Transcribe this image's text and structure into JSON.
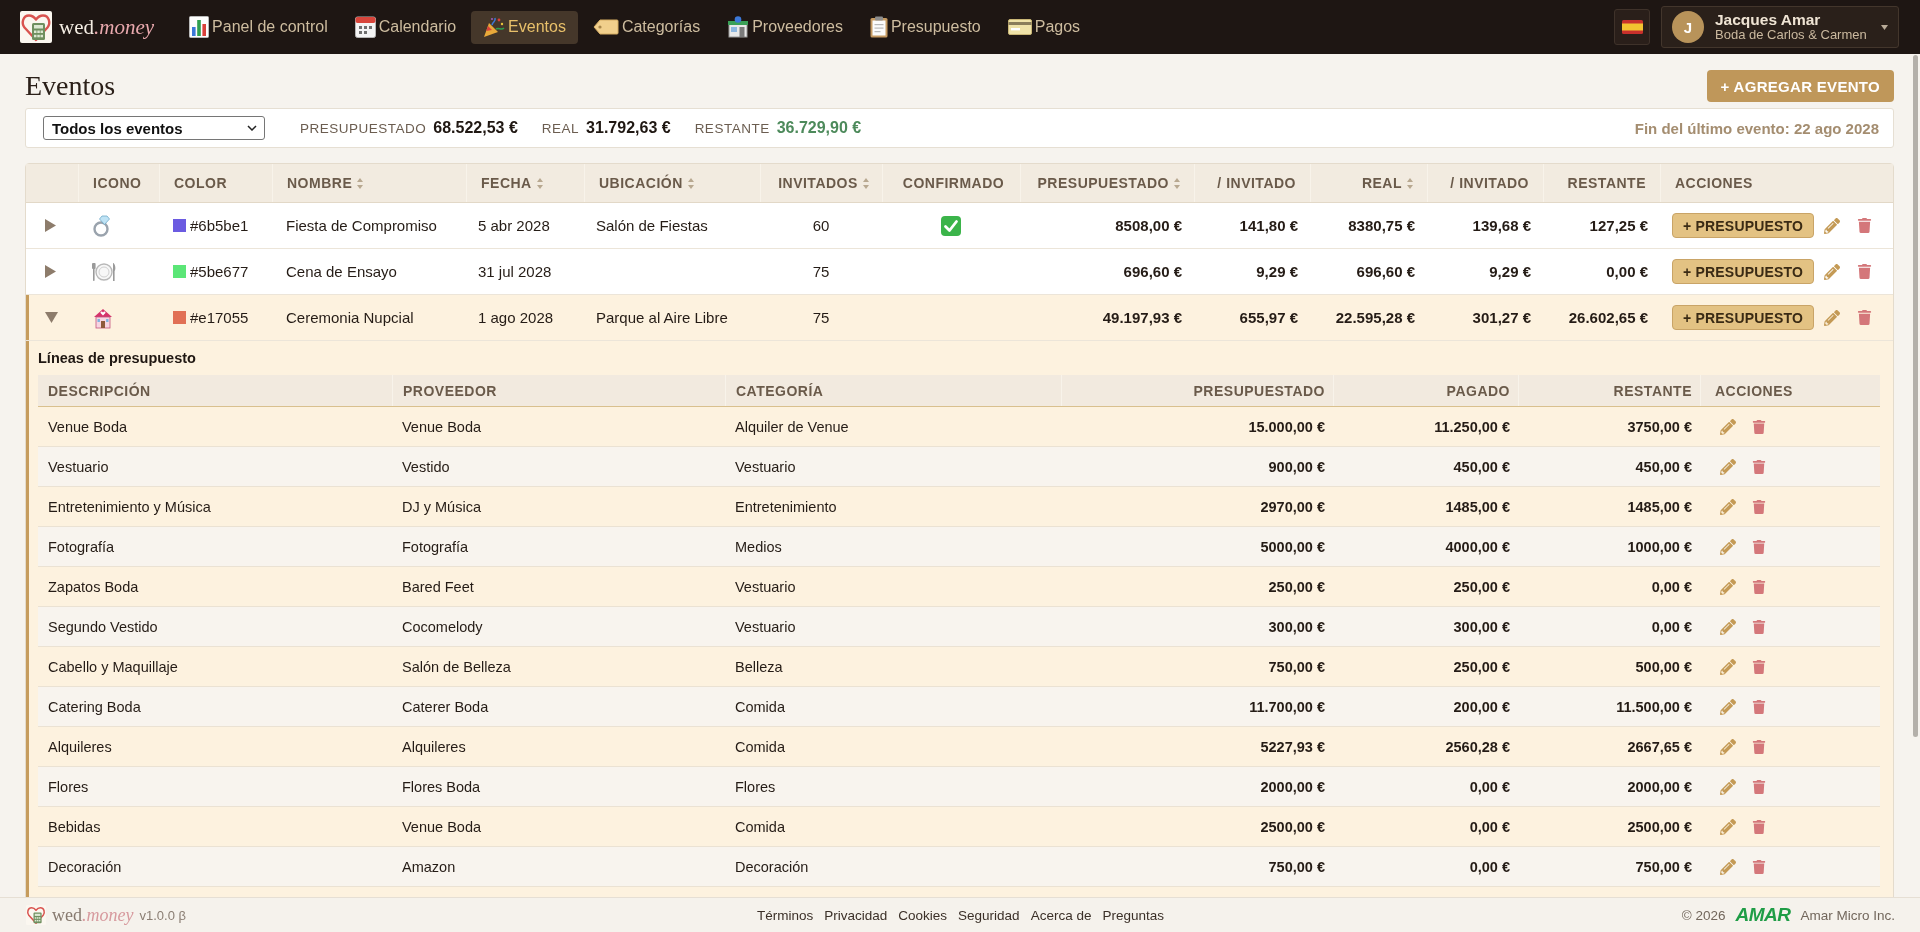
{
  "nav": {
    "brand": {
      "main": "wed",
      "accent": ".money"
    },
    "items": [
      {
        "label": "Panel de control",
        "selected": false
      },
      {
        "label": "Calendario",
        "selected": false
      },
      {
        "label": "Eventos",
        "selected": true
      },
      {
        "label": "Categorías",
        "selected": false
      },
      {
        "label": "Proveedores",
        "selected": false
      },
      {
        "label": "Presupuesto",
        "selected": false
      },
      {
        "label": "Pagos",
        "selected": false
      }
    ],
    "user": {
      "initial": "J",
      "name": "Jacques Amar",
      "subtitle": "Boda de Carlos & Carmen"
    }
  },
  "page": {
    "title": "Eventos",
    "add_button": "+ AGREGAR EVENTO"
  },
  "summary": {
    "filter": {
      "value": "Todos los eventos"
    },
    "totals": [
      {
        "label": "PRESUPUESTADO",
        "value": "68.522,53 €",
        "kind": "plain"
      },
      {
        "label": "REAL",
        "value": "31.792,63 €",
        "kind": "plain"
      },
      {
        "label": "RESTANTE",
        "value": "36.729,90 €",
        "kind": "positive"
      }
    ],
    "last_event": "Fin del último evento: 22 ago 2028"
  },
  "events": {
    "columns": [
      {
        "label": "ICONO",
        "sortable": false
      },
      {
        "label": "COLOR",
        "sortable": false
      },
      {
        "label": "NOMBRE",
        "sortable": true
      },
      {
        "label": "FECHA",
        "sortable": true
      },
      {
        "label": "UBICACIÓN",
        "sortable": true
      },
      {
        "label": "INVITADOS",
        "sortable": true
      },
      {
        "label": "CONFIRMADO",
        "sortable": false
      },
      {
        "label": "PRESUPUESTADO",
        "sortable": true
      },
      {
        "label": "/ INVITADO",
        "sortable": false
      },
      {
        "label": "REAL",
        "sortable": true
      },
      {
        "label": "/ INVITADO",
        "sortable": false
      },
      {
        "label": "RESTANTE",
        "sortable": false
      },
      {
        "label": "ACCIONES",
        "sortable": false
      }
    ],
    "rows": [
      {
        "expanded": false,
        "color": "#6b5be1",
        "color_code": "#6b5be1",
        "name": "Fiesta de Compromiso",
        "date": "5 abr 2028",
        "location": "Salón de Fiestas",
        "guests": "60",
        "confirmed": true,
        "budgeted": "8508,00 €",
        "budgeted_per_guest": "141,80 €",
        "actual": "8380,75 €",
        "actual_per_guest": "139,68 €",
        "remaining": "127,25 €",
        "budget_button": "+ PRESUPUESTO"
      },
      {
        "expanded": false,
        "color": "#5be677",
        "color_code": "#5be677",
        "name": "Cena de Ensayo",
        "date": "31 jul 2028",
        "guests": "75",
        "confirmed": false,
        "budgeted": "696,60 €",
        "budgeted_per_guest": "9,29 €",
        "actual": "696,60 €",
        "actual_per_guest": "9,29 €",
        "remaining": "0,00 €",
        "budget_button": "+ PRESUPUESTO"
      },
      {
        "expanded": true,
        "color": "#e17055",
        "color_code": "#e17055",
        "name": "Ceremonia Nupcial",
        "date": "1 ago 2028",
        "location": "Parque al Aire Libre",
        "guests": "75",
        "confirmed": false,
        "budgeted": "49.197,93 €",
        "budgeted_per_guest": "655,97 €",
        "actual": "22.595,28 €",
        "actual_per_guest": "301,27 €",
        "remaining": "26.602,65 €",
        "budget_button": "+ PRESUPUESTO",
        "budget_lines": {
          "title": "Líneas de presupuesto",
          "columns": [
            "DESCRIPCIÓN",
            "PROVEEDOR",
            "CATEGORÍA",
            "PRESUPUESTADO",
            "PAGADO",
            "RESTANTE",
            "ACCIONES"
          ],
          "rows": [
            {
              "description": "Venue Boda",
              "vendor": "Venue Boda",
              "category": "Alquiler de Venue",
              "budgeted": "15.000,00 €",
              "paid": "11.250,00 €",
              "remaining": "3750,00 €"
            },
            {
              "description": "Vestuario",
              "vendor": "Vestido",
              "category": "Vestuario",
              "budgeted": "900,00 €",
              "paid": "450,00 €",
              "remaining": "450,00 €"
            },
            {
              "description": "Entretenimiento y Música",
              "vendor": "DJ y Música",
              "category": "Entretenimiento",
              "budgeted": "2970,00 €",
              "paid": "1485,00 €",
              "remaining": "1485,00 €"
            },
            {
              "description": "Fotografía",
              "vendor": "Fotografía",
              "category": "Medios",
              "budgeted": "5000,00 €",
              "paid": "4000,00 €",
              "remaining": "1000,00 €"
            },
            {
              "description": "Zapatos Boda",
              "vendor": "Bared Feet",
              "category": "Vestuario",
              "budgeted": "250,00 €",
              "paid": "250,00 €",
              "remaining": "0,00 €"
            },
            {
              "description": "Segundo Vestido",
              "vendor": "Cocomelody",
              "category": "Vestuario",
              "budgeted": "300,00 €",
              "paid": "300,00 €",
              "remaining": "0,00 €"
            },
            {
              "description": "Cabello y Maquillaje",
              "vendor": "Salón de Belleza",
              "category": "Belleza",
              "budgeted": "750,00 €",
              "paid": "250,00 €",
              "remaining": "500,00 €"
            },
            {
              "description": "Catering Boda",
              "vendor": "Caterer Boda",
              "category": "Comida",
              "budgeted": "11.700,00 €",
              "paid": "200,00 €",
              "remaining": "11.500,00 €"
            },
            {
              "description": "Alquileres",
              "vendor": "Alquileres",
              "category": "Comida",
              "budgeted": "5227,93 €",
              "paid": "2560,28 €",
              "remaining": "2667,65 €"
            },
            {
              "description": "Flores",
              "vendor": "Flores Boda",
              "category": "Flores",
              "budgeted": "2000,00 €",
              "paid": "0,00 €",
              "remaining": "2000,00 €"
            },
            {
              "description": "Bebidas",
              "vendor": "Venue Boda",
              "category": "Comida",
              "budgeted": "2500,00 €",
              "paid": "0,00 €",
              "remaining": "2500,00 €"
            },
            {
              "description": "Decoración",
              "vendor": "Amazon",
              "category": "Decoración",
              "budgeted": "750,00 €",
              "paid": "0,00 €",
              "remaining": "750,00 €"
            }
          ]
        }
      }
    ]
  },
  "footer": {
    "brand": {
      "main": "wed",
      "accent": ".money"
    },
    "version": "v1.0.0 β",
    "links": [
      "Términos",
      "Privacidad",
      "Cookies",
      "Seguridad",
      "Acerca de",
      "Preguntas"
    ],
    "copyright": "© 2026",
    "company_logo": "AMAR",
    "company": "Amar Micro Inc."
  }
}
